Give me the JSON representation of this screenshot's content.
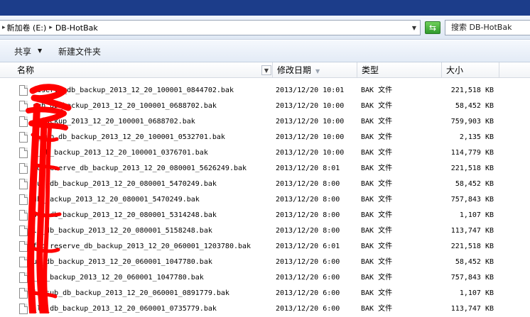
{
  "address": {
    "crumbs": [
      "新加卷 (E:)",
      "DB-HotBak"
    ]
  },
  "search": {
    "text": "搜索 DB-HotBak"
  },
  "toolbar": {
    "share_label": "共享",
    "new_folder_label": "新建文件夹"
  },
  "columns": {
    "name": "名称",
    "date": "修改日期",
    "type": "类型",
    "size": "大小"
  },
  "files": [
    {
      "name": "reserve_db_backup_2013_12_20_100001_0844702.bak",
      "date": "2013/12/20 10:01",
      "type": "BAK 文件",
      "size": "221,518 KB"
    },
    {
      "name": "sub_db_backup_2013_12_20_100001_0688702.bak",
      "date": "2013/12/20 10:00",
      "type": "BAK 文件",
      "size": "58,452 KB"
    },
    {
      "name": "b_backup_2013_12_20_100001_0688702.bak",
      "date": "2013/12/20 10:00",
      "type": "BAK 文件",
      "size": "759,903 KB"
    },
    {
      "name": "s_sub_db_backup_2013_12_20_100001_0532701.bak",
      "date": "2013/12/20 10:00",
      "type": "BAK 文件",
      "size": "2,135 KB"
    },
    {
      "name": "s_db_backup_2013_12_20_100001_0376701.bak",
      "date": "2013/12/20 10:00",
      "type": "BAK 文件",
      "size": "114,779 KB"
    },
    {
      "name": "id_reserve_db_backup_2013_12_20_080001_5626249.bak",
      "date": "2013/12/20 8:01",
      "type": "BAK 文件",
      "size": "221,518 KB"
    },
    {
      "name": "sub_db_backup_2013_12_20_080001_5470249.bak",
      "date": "2013/12/20 8:00",
      "type": "BAK 文件",
      "size": "58,452 KB"
    },
    {
      "name": "db_backup_2013_12_20_080001_5470249.bak",
      "date": "2013/12/20 8:00",
      "type": "BAK 文件",
      "size": "757,843 KB"
    },
    {
      "name": "sub_db_backup_2013_12_20_080001_5314248.bak",
      "date": "2013/12/20 8:00",
      "type": "BAK 文件",
      "size": "1,107 KB"
    },
    {
      "name": "ls_db_backup_2013_12_20_080001_5158248.bak",
      "date": "2013/12/20 8:00",
      "type": "BAK 文件",
      "size": "113,747 KB"
    },
    {
      "name": "fic_reserve_db_backup_2013_12_20_060001_1203780.bak",
      "date": "2013/12/20 6:01",
      "type": "BAK 文件",
      "size": "221,518 KB"
    },
    {
      "name": "ub_db_backup_2013_12_20_060001_1047780.bak",
      "date": "2013/12/20 6:00",
      "type": "BAK 文件",
      "size": "58,452 KB"
    },
    {
      "name": "_db_backup_2013_12_20_060001_1047780.bak",
      "date": "2013/12/20 6:00",
      "type": "BAK 文件",
      "size": "757,843 KB"
    },
    {
      "name": "is_sub_db_backup_2013_12_20_060001_0891779.bak",
      "date": "2013/12/20 6:00",
      "type": "BAK 文件",
      "size": "1,107 KB"
    },
    {
      "name": "_ls_db_backup_2013_12_20_060001_0735779.bak",
      "date": "2013/12/20 6:00",
      "type": "BAK 文件",
      "size": "113,747 KB"
    }
  ],
  "colors": {
    "titlebar": "#1c3d8a",
    "scribble": "#ff0000"
  }
}
